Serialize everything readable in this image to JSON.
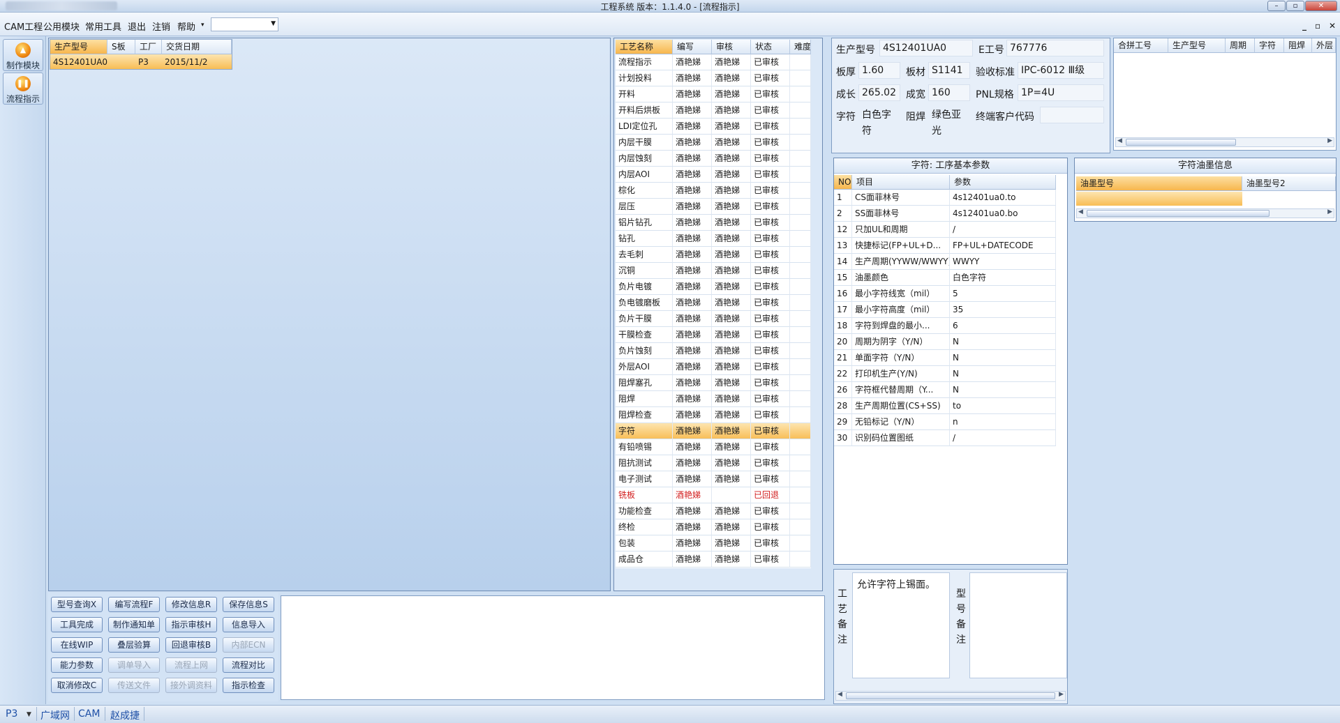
{
  "window": {
    "title": "工程系统   版本：1.1.4.0 - [流程指示]",
    "min": "–",
    "max": "▫",
    "close": "✕"
  },
  "menu": {
    "items": [
      "CAM工程",
      "公用模块",
      "常用工具",
      "退出",
      "注销",
      "帮助"
    ],
    "help_arrow": "▾",
    "combo_value": "",
    "mdi_controls": [
      "_",
      "▫",
      "✕"
    ]
  },
  "nav": {
    "items": [
      {
        "label": "制作模块",
        "icon": "fire-icon"
      },
      {
        "label": "流程指示",
        "icon": "pause-icon"
      }
    ]
  },
  "orders": {
    "columns": [
      "生产型号",
      "S板",
      "工厂",
      "交货日期"
    ],
    "rows": [
      {
        "model": "4S12401UA0",
        "s": "",
        "factory": "P3",
        "date": "2015/11/2"
      }
    ]
  },
  "process": {
    "columns": [
      "工艺名称",
      "编写",
      "审核",
      "状态",
      "难度"
    ],
    "rows": [
      {
        "name": "流程指示",
        "writer": "酒艳娣",
        "reviewer": "酒艳娣",
        "status": "已审核"
      },
      {
        "name": "计划投料",
        "writer": "酒艳娣",
        "reviewer": "酒艳娣",
        "status": "已审核"
      },
      {
        "name": "开料",
        "writer": "酒艳娣",
        "reviewer": "酒艳娣",
        "status": "已审核"
      },
      {
        "name": "开料后烘板",
        "writer": "酒艳娣",
        "reviewer": "酒艳娣",
        "status": "已审核"
      },
      {
        "name": "LDI定位孔",
        "writer": "酒艳娣",
        "reviewer": "酒艳娣",
        "status": "已审核"
      },
      {
        "name": "内层干膜",
        "writer": "酒艳娣",
        "reviewer": "酒艳娣",
        "status": "已审核"
      },
      {
        "name": "内层蚀刻",
        "writer": "酒艳娣",
        "reviewer": "酒艳娣",
        "status": "已审核"
      },
      {
        "name": "内层AOI",
        "writer": "酒艳娣",
        "reviewer": "酒艳娣",
        "status": "已审核"
      },
      {
        "name": "棕化",
        "writer": "酒艳娣",
        "reviewer": "酒艳娣",
        "status": "已审核"
      },
      {
        "name": "层压",
        "writer": "酒艳娣",
        "reviewer": "酒艳娣",
        "status": "已审核"
      },
      {
        "name": "铝片钻孔",
        "writer": "酒艳娣",
        "reviewer": "酒艳娣",
        "status": "已审核"
      },
      {
        "name": "钻孔",
        "writer": "酒艳娣",
        "reviewer": "酒艳娣",
        "status": "已审核"
      },
      {
        "name": "去毛刺",
        "writer": "酒艳娣",
        "reviewer": "酒艳娣",
        "status": "已审核"
      },
      {
        "name": "沉铜",
        "writer": "酒艳娣",
        "reviewer": "酒艳娣",
        "status": "已审核"
      },
      {
        "name": "负片电镀",
        "writer": "酒艳娣",
        "reviewer": "酒艳娣",
        "status": "已审核"
      },
      {
        "name": "负电镀磨板",
        "writer": "酒艳娣",
        "reviewer": "酒艳娣",
        "status": "已审核"
      },
      {
        "name": "负片干膜",
        "writer": "酒艳娣",
        "reviewer": "酒艳娣",
        "status": "已审核"
      },
      {
        "name": "干膜检查",
        "writer": "酒艳娣",
        "reviewer": "酒艳娣",
        "status": "已审核"
      },
      {
        "name": "负片蚀刻",
        "writer": "酒艳娣",
        "reviewer": "酒艳娣",
        "status": "已审核"
      },
      {
        "name": "外层AOI",
        "writer": "酒艳娣",
        "reviewer": "酒艳娣",
        "status": "已审核"
      },
      {
        "name": "阻焊塞孔",
        "writer": "酒艳娣",
        "reviewer": "酒艳娣",
        "status": "已审核"
      },
      {
        "name": "阻焊",
        "writer": "酒艳娣",
        "reviewer": "酒艳娣",
        "status": "已审核"
      },
      {
        "name": "阻焊检查",
        "writer": "酒艳娣",
        "reviewer": "酒艳娣",
        "status": "已审核"
      },
      {
        "name": "字符",
        "writer": "酒艳娣",
        "reviewer": "酒艳娣",
        "status": "已审核"
      },
      {
        "name": "有铅喷锡",
        "writer": "酒艳娣",
        "reviewer": "酒艳娣",
        "status": "已审核"
      },
      {
        "name": "阻抗测试",
        "writer": "酒艳娣",
        "reviewer": "酒艳娣",
        "status": "已审核"
      },
      {
        "name": "电子测试",
        "writer": "酒艳娣",
        "reviewer": "酒艳娣",
        "status": "已审核"
      },
      {
        "name": "铣板",
        "writer": "酒艳娣",
        "reviewer": "",
        "status": "已回退"
      },
      {
        "name": "功能检查",
        "writer": "酒艳娣",
        "reviewer": "酒艳娣",
        "status": "已审核"
      },
      {
        "name": "终检",
        "writer": "酒艳娣",
        "reviewer": "酒艳娣",
        "status": "已审核"
      },
      {
        "name": "包装",
        "writer": "酒艳娣",
        "reviewer": "酒艳娣",
        "status": "已审核"
      },
      {
        "name": "成品仓",
        "writer": "酒艳娣",
        "reviewer": "酒艳娣",
        "status": "已审核"
      }
    ],
    "status_back_color": "#d21d1d",
    "selected_color": "#f8bd55"
  },
  "actions": {
    "rows": [
      [
        "型号查询X",
        "编写流程F",
        "修改信息R",
        "保存信息S"
      ],
      [
        "工具完成",
        "制作通知单",
        "指示审核H",
        "信息导入"
      ],
      [
        "在线WIP",
        "叠层验算",
        "回退审核B",
        "内部ECN"
      ],
      [
        "能力参数",
        "调单导入",
        "流程上网",
        "流程对比"
      ],
      [
        "取消修改C",
        "传送文件",
        "接外调资料",
        "指示检查"
      ]
    ]
  },
  "info": {
    "model_label": "生产型号",
    "model": "4S12401UA0",
    "eno_label": "E工号",
    "eno": "767776",
    "thick_label": "板厚",
    "thick": "1.60",
    "mat_label": "板材",
    "mat": "S1141",
    "std_label": "验收标准",
    "std": "IPC-6012 Ⅲ级",
    "len_label": "成长",
    "len": "265.02",
    "wid_label": "成宽",
    "wid": "160",
    "pnl_label": "PNL规格",
    "pnl": "1P=4U",
    "char_label": "字符",
    "char": "白色字符",
    "mask_label": "阻焊",
    "mask": "绿色亚光",
    "cust_label": "终端客户代码",
    "cust": ""
  },
  "combo": {
    "columns": [
      "合拼工号",
      "生产型号",
      "周期",
      "字符",
      "阻焊",
      "外层"
    ]
  },
  "params": {
    "title": "字符: 工序基本参数",
    "columns": [
      "NO",
      "项目",
      "参数"
    ],
    "rows": [
      {
        "no": "1",
        "item": "CS面菲林号",
        "val": "4s12401ua0.to"
      },
      {
        "no": "2",
        "item": "SS面菲林号",
        "val": "4s12401ua0.bo"
      },
      {
        "no": "12",
        "item": "只加UL和周期",
        "val": "/"
      },
      {
        "no": "13",
        "item": "快捷标记(FP+UL+D...",
        "val": "FP+UL+DATECODE"
      },
      {
        "no": "14",
        "item": "生产周期(YYWW/WWYY)",
        "val": "WWYY"
      },
      {
        "no": "15",
        "item": "油墨颜色",
        "val": "白色字符"
      },
      {
        "no": "16",
        "item": "最小字符线宽（mil）",
        "val": "5"
      },
      {
        "no": "17",
        "item": "最小字符高度（mil）",
        "val": "35"
      },
      {
        "no": "18",
        "item": "字符到焊盘的最小...",
        "val": "6"
      },
      {
        "no": "20",
        "item": "周期为阴字（Y/N）",
        "val": "N"
      },
      {
        "no": "21",
        "item": "单面字符（Y/N）",
        "val": "N"
      },
      {
        "no": "22",
        "item": "打印机生产(Y/N)",
        "val": "N"
      },
      {
        "no": "26",
        "item": "字符框代替周期（Y...",
        "val": "N"
      },
      {
        "no": "28",
        "item": "生产周期位置(CS+SS)",
        "val": "to"
      },
      {
        "no": "29",
        "item": "无铅标记（Y/N）",
        "val": "n"
      },
      {
        "no": "30",
        "item": "识别码位置图纸",
        "val": "/"
      }
    ]
  },
  "ink": {
    "title": "字符油墨信息",
    "columns": [
      "油墨型号",
      "油墨型号2"
    ]
  },
  "notes": {
    "process_label": "工艺备注",
    "process_text": "允许字符上锡面。",
    "model_label": "型号备注",
    "model_text": ""
  },
  "status": {
    "factory": "P3",
    "network": "广域网",
    "dept": "CAM",
    "user": "赵成捷"
  }
}
